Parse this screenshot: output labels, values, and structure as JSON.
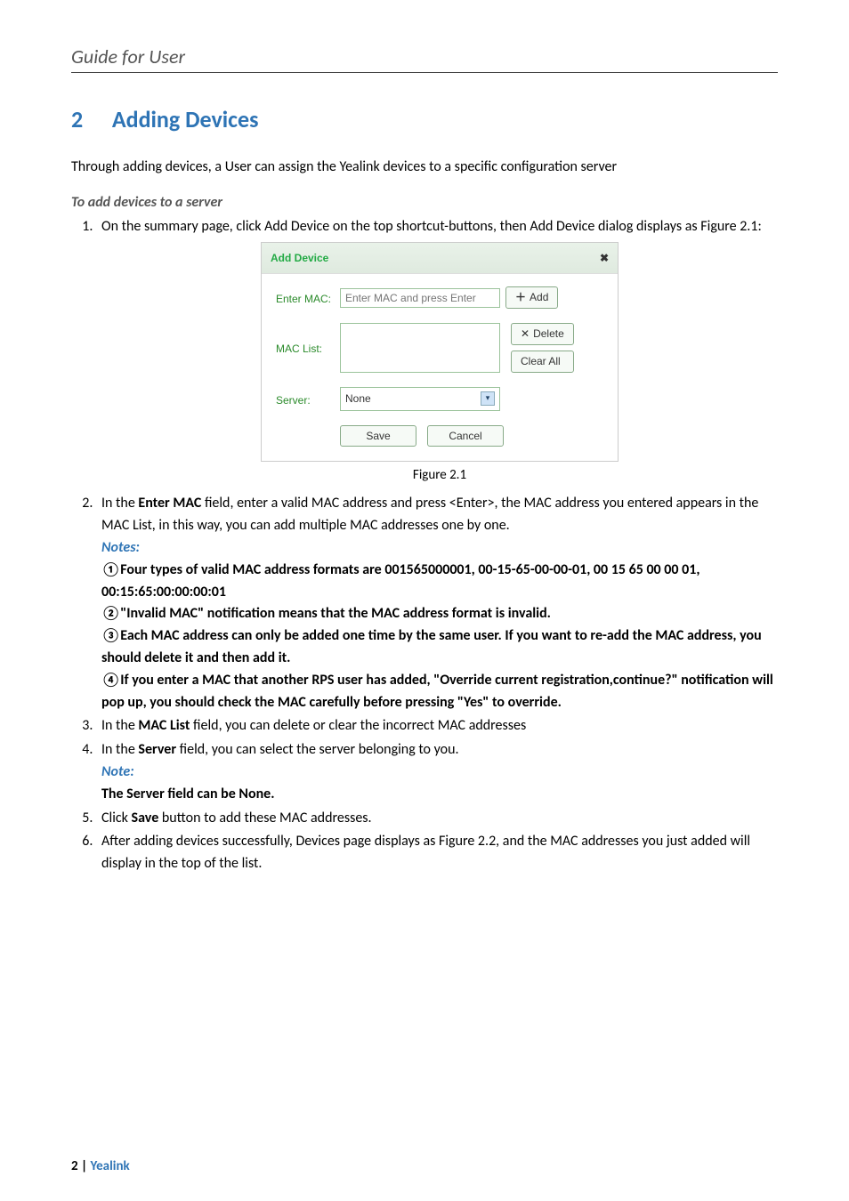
{
  "header": {
    "title": "Guide for User"
  },
  "section": {
    "number": "2",
    "title": "Adding Devices"
  },
  "intro": "Through adding devices, a User can assign the Yealink devices to a specific configuration server",
  "subheading": "To add devices to a server",
  "list": {
    "item1": "On the summary page, click Add Device on the top shortcut-buttons, then Add Device dialog displays as Figure 2.1:",
    "item2": {
      "prefix": "In the ",
      "bold1": "Enter MAC",
      "mid": " field, enter a valid MAC address and press <Enter>, the MAC address you entered appears in the MAC List, in this way, you can add multiple MAC addresses one by one.",
      "notes_label": "Notes:",
      "n1": "①Four types of valid MAC address formats are 001565000001, 00-15-65-00-00-01, 00 15 65 00 00 01, 00:15:65:00:00:00:01",
      "n2": "②\"Invalid MAC\" notification means that the MAC address format is invalid.",
      "n3": "③Each MAC address can only be added one time by the same user. If you want to re-add the MAC address, you should delete it and then add it.",
      "n4": "④If you enter a MAC that another RPS user has added, \"Override current registration,continue?\" notification will pop up, you should check the MAC carefully before pressing \"Yes\" to override."
    },
    "item3": {
      "prefix": "In the ",
      "bold": "MAC List",
      "suffix": " field, you can delete or clear the incorrect MAC addresses"
    },
    "item4": {
      "prefix": "In the ",
      "bold": "Server",
      "suffix": " field, you can select the server belonging to you.",
      "note_label": "Note:",
      "note_body": " The Server field can be None."
    },
    "item5": {
      "prefix": "Click ",
      "bold": "Save",
      "suffix": " button to add these MAC addresses."
    },
    "item6": "After adding devices successfully, Devices page displays as Figure 2.2, and the MAC addresses you just added will display in the top of the list."
  },
  "dialog": {
    "title": "Add Device",
    "close": "✖",
    "labels": {
      "enter_mac": "Enter MAC:",
      "mac_list": "MAC List:",
      "server": "Server:"
    },
    "placeholders": {
      "enter_mac": "Enter MAC and press Enter"
    },
    "buttons": {
      "add": "Add",
      "delete": "Delete",
      "clear_all": "Clear All",
      "save": "Save",
      "cancel": "Cancel"
    },
    "server_value": "None"
  },
  "figure_caption": "Figure 2.1",
  "footer": {
    "page": "2",
    "sep": " | ",
    "brand": "Yealink"
  }
}
